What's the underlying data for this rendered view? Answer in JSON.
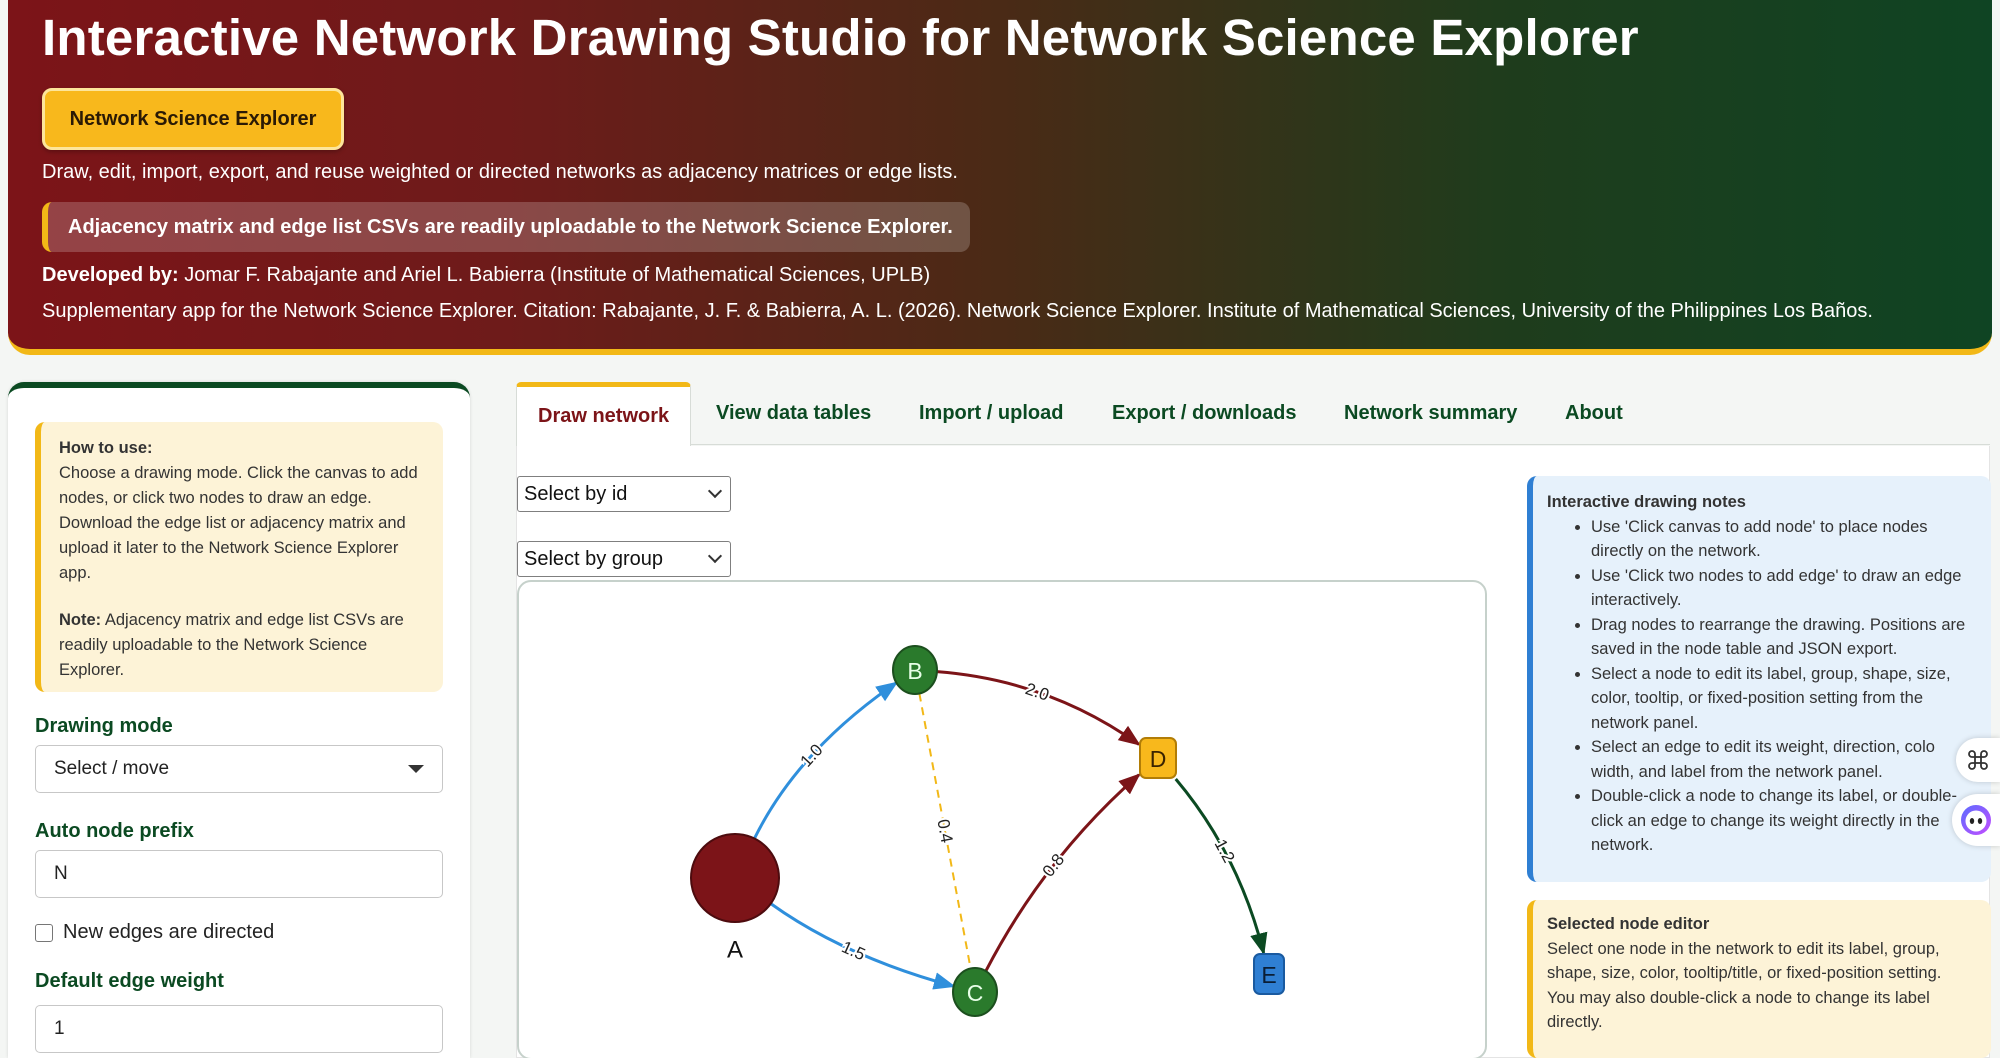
{
  "header": {
    "title": "Interactive Network Drawing Studio for Network Science Explorer",
    "badge": "Network Science Explorer",
    "description": "Draw, edit, import, export, and reuse weighted or directed networks as adjacency matrices or edge lists.",
    "notice": "Adjacency matrix and edge list CSVs are readily uploadable to the Network Science Explorer.",
    "developed_label": "Developed by:",
    "developed_value": " Jomar F. Rabajante and Ariel L. Babierra (Institute of Mathematical Sciences, UPLB)",
    "citation": "Supplementary app for the Network Science Explorer. Citation: Rabajante, J. F. & Babierra, A. L. (2026). Network Science Explorer. Institute of Mathematical Sciences, University of the Philippines Los Baños."
  },
  "sidebar": {
    "howto_title": "How to use:",
    "howto_text": "Choose a drawing mode. Click the canvas to add nodes, or click two nodes to draw an edge. Download the edge list or adjacency matrix and upload it later to the Network Science Explorer app.",
    "note_label": "Note:",
    "note_text": " Adjacency matrix and edge list CSVs are readily uploadable to the Network Science Explorer.",
    "drawing_mode_label": "Drawing mode",
    "drawing_mode_value": "Select / move",
    "prefix_label": "Auto node prefix",
    "prefix_value": "N",
    "directed_label": "New edges are directed",
    "weight_label": "Default edge weight",
    "weight_value": "1"
  },
  "tabs": [
    {
      "label": "Draw network",
      "active": true
    },
    {
      "label": "View data tables"
    },
    {
      "label": "Import / upload"
    },
    {
      "label": "Export / downloads"
    },
    {
      "label": "Network summary"
    },
    {
      "label": "About"
    }
  ],
  "main": {
    "select_id": "Select by id",
    "select_group": "Select by group"
  },
  "network": {
    "nodes": [
      {
        "id": "A",
        "color": "#7c1418",
        "shape": "circle-large"
      },
      {
        "id": "B",
        "color": "#2a7a2c",
        "shape": "ellipse"
      },
      {
        "id": "C",
        "color": "#2a7a2c",
        "shape": "ellipse"
      },
      {
        "id": "D",
        "color": "#f8b81c",
        "shape": "box"
      },
      {
        "id": "E",
        "color": "#2f7fd3",
        "shape": "box"
      }
    ],
    "edges": [
      {
        "from": "A",
        "to": "B",
        "weight": "1.0",
        "color": "#2f8fdc",
        "directed": true
      },
      {
        "from": "A",
        "to": "C",
        "weight": "1.5",
        "color": "#2f8fdc",
        "directed": true
      },
      {
        "from": "B",
        "to": "D",
        "weight": "2.0",
        "color": "#7c1418",
        "directed": true
      },
      {
        "from": "C",
        "to": "D",
        "weight": "0.8",
        "color": "#7c1418",
        "directed": true
      },
      {
        "from": "D",
        "to": "E",
        "weight": "1.2",
        "color": "#0b4a22",
        "directed": true
      },
      {
        "from": "B",
        "to": "C",
        "weight": "0.4",
        "color": "#f2b817",
        "directed": false,
        "dashed": true
      }
    ]
  },
  "notes": {
    "title": "Interactive drawing notes",
    "items": [
      "Use 'Click canvas to add node' to place nodes directly on the network.",
      "Use 'Click two nodes to add edge' to draw an edge interactively.",
      "Drag nodes to rearrange the drawing. Positions are saved in the node table and JSON export.",
      "Select a node to edit its label, group, shape, size, color, tooltip, or fixed-position setting from the network panel.",
      "Select an edge to edit its weight, direction, colo width, and label from the network panel.",
      "Double-click a node to change its label, or double-click an edge to change its weight directly in the network."
    ]
  },
  "node_editor": {
    "title": "Selected node editor",
    "text": "Select one node in the network to edit its label, group, shape, size, color, tooltip/title, or fixed-position setting. You may also double-click a node to change its label directly."
  },
  "colors": {
    "maroon": "#7c1418",
    "forest": "#0b4a22",
    "gold": "#f2b817",
    "blue": "#2f7fd3"
  }
}
